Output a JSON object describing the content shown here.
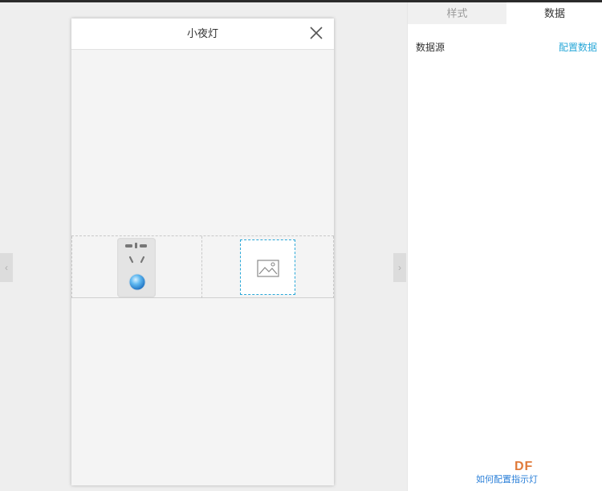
{
  "phone": {
    "title": "小夜灯"
  },
  "panel": {
    "tabs": [
      {
        "label": "样式"
      },
      {
        "label": "数据"
      }
    ],
    "datasource_label": "数据源",
    "configure_link": "配置数据"
  },
  "watermark": {
    "logo": "DF",
    "text": "如何配置指示灯"
  },
  "colors": {
    "accent": "#2aa8d8",
    "logo": "#e07a3a"
  },
  "icons": {
    "close": "close-icon",
    "socket": "power-socket-icon",
    "image": "image-placeholder-icon",
    "nav_left": "chevron-left-icon",
    "nav_right": "chevron-right-icon"
  }
}
